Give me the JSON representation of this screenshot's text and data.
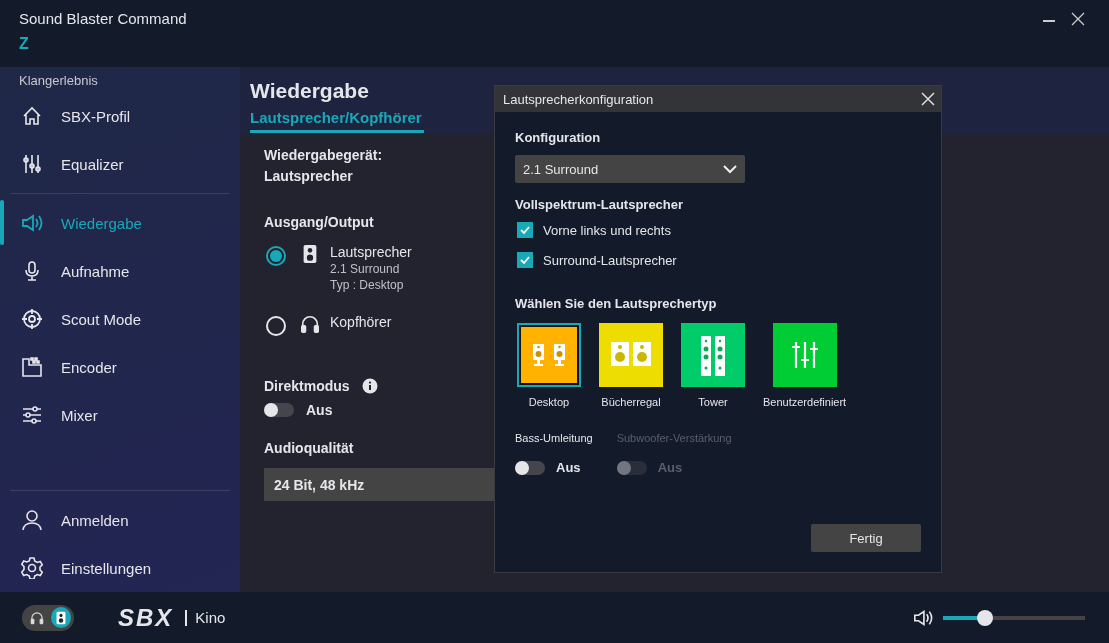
{
  "window": {
    "title": "Sound Blaster Command",
    "logo": "Z",
    "controls": [
      {
        "kind": "minimize"
      },
      {
        "kind": "close"
      }
    ]
  },
  "sidebar": {
    "section_label": "Klangerlebnis",
    "items": [
      {
        "label": "SBX-Profil",
        "kind": "home",
        "selected": false
      },
      {
        "label": "Equalizer",
        "kind": "equalizer",
        "selected": false
      },
      {
        "label": "Wiedergabe",
        "kind": "speaker",
        "selected": true
      },
      {
        "label": "Aufnahme",
        "kind": "mic",
        "selected": false
      },
      {
        "label": "Scout Mode",
        "kind": "target",
        "selected": false
      },
      {
        "label": "Encoder",
        "kind": "encoder",
        "selected": false
      },
      {
        "label": "Mixer",
        "kind": "mixer",
        "selected": false
      }
    ],
    "footer_items": [
      {
        "label": "Anmelden",
        "kind": "person",
        "selected": false
      },
      {
        "label": "Einstellungen",
        "kind": "gear",
        "selected": false
      }
    ]
  },
  "page": {
    "title": "Wiedergabe",
    "tabs": [
      {
        "label": "Lautsprecher/Kopfhörer",
        "selected": true
      }
    ],
    "device_label": "Wiedergabegerät:",
    "device_name": "Lautsprecher",
    "output": {
      "heading": "Ausgang/Output",
      "options": [
        {
          "kind": "speaker",
          "label": "Lautsprecher",
          "details": [
            "2.1 Surround",
            "Typ :  Desktop"
          ],
          "selected": true
        },
        {
          "kind": "headphones",
          "label": "Kopfhörer",
          "selected": false
        }
      ]
    },
    "direct_mode": {
      "label": "Direktmodus",
      "on": false,
      "state_text": "Aus"
    },
    "audio_quality": {
      "label": "Audioqualität",
      "value": "24 Bit, 48 kHz"
    }
  },
  "dialog": {
    "title": "Lautsprecherkonfiguration",
    "config_label": "Konfiguration",
    "config_value": "2.1 Surround",
    "fullrange_label": "Vollspektrum-Lautsprecher",
    "checkboxes": [
      {
        "label": "Vorne links und rechts",
        "checked": true
      },
      {
        "label": "Surround-Lautsprecher",
        "checked": true
      }
    ],
    "type_label": "Wählen Sie den Lautsprechertyp",
    "types": [
      {
        "label": "Desktop",
        "kind": "desktop",
        "color": "#ffb300",
        "selected": true
      },
      {
        "label": "Bücherregal",
        "kind": "bookshelf",
        "color": "#eedd00",
        "selected": false
      },
      {
        "label": "Tower",
        "kind": "tower",
        "color": "#00cc6a",
        "selected": false
      },
      {
        "label": "Benutzerdefiniert",
        "kind": "custom",
        "color": "#00cc33",
        "selected": false
      }
    ],
    "toggles": [
      {
        "label": "Bass-Umleitung",
        "state_text": "Aus",
        "on": false,
        "disabled": false
      },
      {
        "label": "Subwoofer-Verstärkung",
        "state_text": "Aus",
        "on": false,
        "disabled": true
      }
    ],
    "button": "Fertig"
  },
  "status_bar": {
    "output_switch": [
      {
        "kind": "headphones",
        "selected": false
      },
      {
        "kind": "speaker",
        "selected": true
      }
    ],
    "brand": "SBX",
    "mode": "Kino",
    "volume": {
      "level": 0.27
    }
  }
}
